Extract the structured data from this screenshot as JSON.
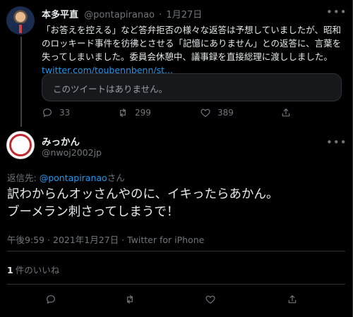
{
  "parent_tweet": {
    "author_name": "本多平直",
    "handle": "@pontapiranao",
    "separator": "·",
    "date": "1月27日",
    "text": "「お答えを控える」など答弁拒否の様々な返答は予想していましたが、昭和のロッキード事件を彷彿とさせる「記憶にありません」との返答に、言葉を失ってしまいました。委員会休憩中、議事録を直接総理に渡ししました。",
    "link": "twitter.com/toubennbenn/st...",
    "quote_unavailable": "このツイートはありません。",
    "reply_count": "33",
    "retweet_count": "299",
    "like_count": "389"
  },
  "main_tweet": {
    "author_name": "みっかん",
    "handle": "@nwoj2002jp",
    "reply_to_prefix": "返信先: ",
    "reply_to_handle": "@pontapiranao",
    "reply_to_suffix": "さん",
    "text_line1": "訳わからんオッさんやのに、イキったらあかん。",
    "text_line2": "ブーメラン刺さってしまうで！",
    "meta": "午後9:59 · 2021年1月27日 · Twitter for iPhone",
    "likes_count": "1",
    "likes_label": "件のいいね"
  },
  "icons": {
    "more": "more-horizontal-icon",
    "reply": "reply-bubble-icon",
    "retweet": "retweet-arrows-icon",
    "like": "heart-icon",
    "share": "share-upload-icon"
  },
  "colors": {
    "background": "#000000",
    "text": "#e7e9ea",
    "muted": "#71767b",
    "link": "#1d9bf0",
    "border": "#2f3336"
  }
}
